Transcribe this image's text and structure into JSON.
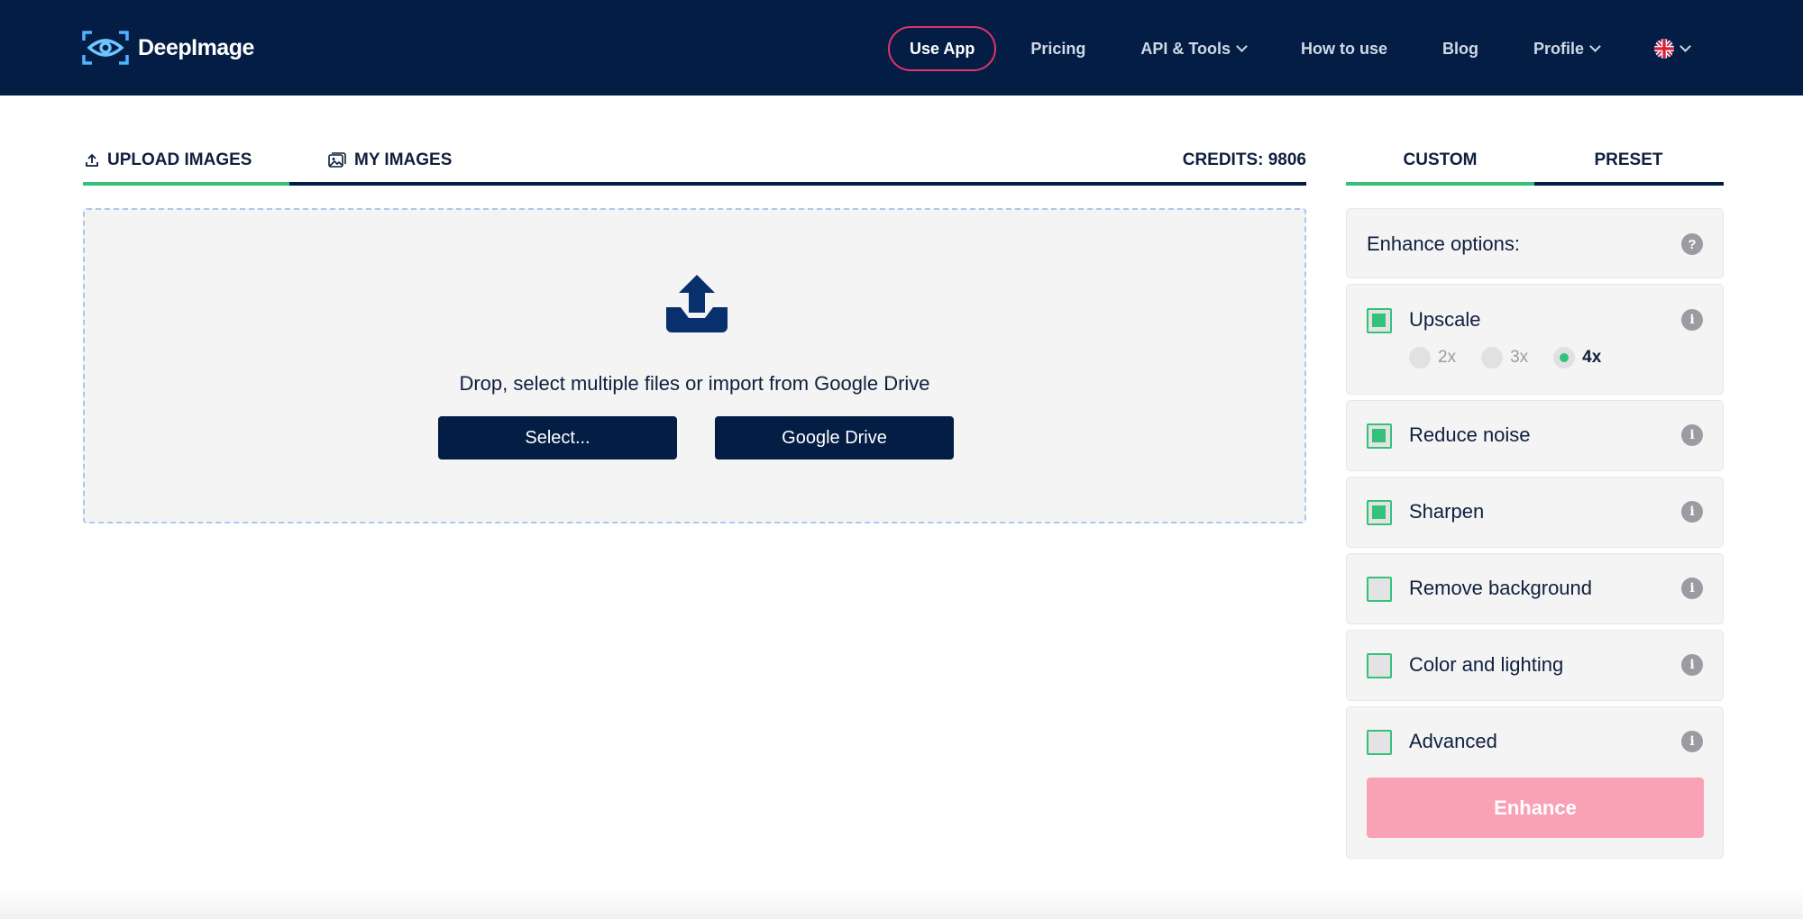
{
  "header": {
    "brand": "DeepImage",
    "nav": [
      {
        "label": "Use App"
      },
      {
        "label": "Pricing"
      },
      {
        "label": "API & Tools"
      },
      {
        "label": "How to use"
      },
      {
        "label": "Blog"
      },
      {
        "label": "Profile"
      }
    ],
    "language_icon": "uk-flag-icon"
  },
  "tabs": {
    "upload": "UPLOAD IMAGES",
    "my_images": "MY IMAGES",
    "credits": "CREDITS: 9806"
  },
  "dropzone": {
    "text": "Drop, select multiple files or import from Google Drive",
    "select_button": "Select...",
    "gdrive_button": "Google Drive"
  },
  "panel": {
    "tabs": {
      "custom": "CUSTOM",
      "preset": "PRESET"
    },
    "title": "Enhance options:",
    "options": [
      {
        "label": "Upscale",
        "checked": true
      },
      {
        "label": "Reduce noise",
        "checked": true
      },
      {
        "label": "Sharpen",
        "checked": true
      },
      {
        "label": "Remove background",
        "checked": false
      },
      {
        "label": "Color and lighting",
        "checked": false
      },
      {
        "label": "Advanced",
        "checked": false
      }
    ],
    "upscale_factors": [
      "2x",
      "3x",
      "4x"
    ],
    "upscale_selected": "4x",
    "enhance_button": "Enhance"
  },
  "colors": {
    "navy": "#031d45",
    "accent_green": "#34c27a",
    "accent_pink": "#e2336b",
    "enhance_disabled": "#f9a1b5"
  }
}
